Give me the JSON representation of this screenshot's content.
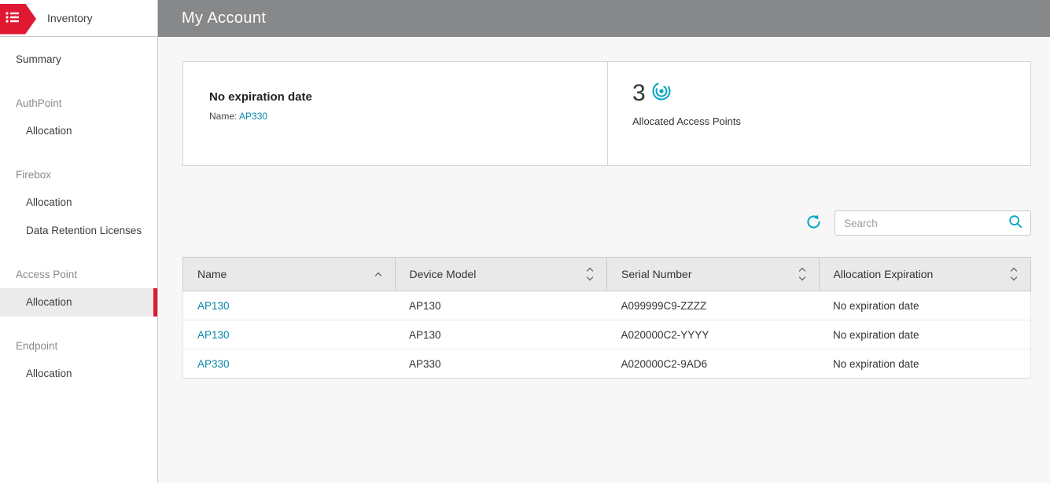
{
  "colors": {
    "brand_red": "#e01933",
    "link_teal": "#0886a8",
    "icon_teal": "#00a5c4",
    "header_gray": "#87888a"
  },
  "sidebar": {
    "app_title": "Inventory",
    "items": [
      {
        "label": "Summary",
        "type": "item"
      },
      {
        "label": "AuthPoint",
        "type": "section"
      },
      {
        "label": "Allocation",
        "type": "subitem"
      },
      {
        "label": "Firebox",
        "type": "section"
      },
      {
        "label": "Allocation",
        "type": "subitem"
      },
      {
        "label": "Data Retention Licenses",
        "type": "subitem"
      },
      {
        "label": "Access Point",
        "type": "section"
      },
      {
        "label": "Allocation",
        "type": "subitem",
        "active": true
      },
      {
        "label": "Endpoint",
        "type": "section"
      },
      {
        "label": "Allocation",
        "type": "subitem"
      }
    ]
  },
  "header": {
    "title": "My Account"
  },
  "summary_cards": {
    "expiration_card": {
      "title": "No expiration date",
      "name_label": "Name:",
      "name_value": "AP330"
    },
    "count_card": {
      "count": "3",
      "label": "Allocated Access Points",
      "icon": "access-point-icon"
    }
  },
  "toolbar": {
    "refresh_icon": "refresh-icon",
    "search_placeholder": "Search",
    "search_value": "",
    "search_icon": "search-icon"
  },
  "table": {
    "columns": [
      {
        "label": "Name",
        "sort": "asc"
      },
      {
        "label": "Device Model",
        "sort": "both"
      },
      {
        "label": "Serial Number",
        "sort": "both"
      },
      {
        "label": "Allocation Expiration",
        "sort": "both"
      }
    ],
    "rows": [
      {
        "name": "AP130",
        "model": "AP130",
        "serial": "A099999C9-ZZZZ",
        "expiration": "No expiration date"
      },
      {
        "name": "AP130",
        "model": "AP130",
        "serial": "A020000C2-YYYY",
        "expiration": "No expiration date"
      },
      {
        "name": "AP330",
        "model": "AP330",
        "serial": "A020000C2-9AD6",
        "expiration": "No expiration date"
      }
    ]
  }
}
